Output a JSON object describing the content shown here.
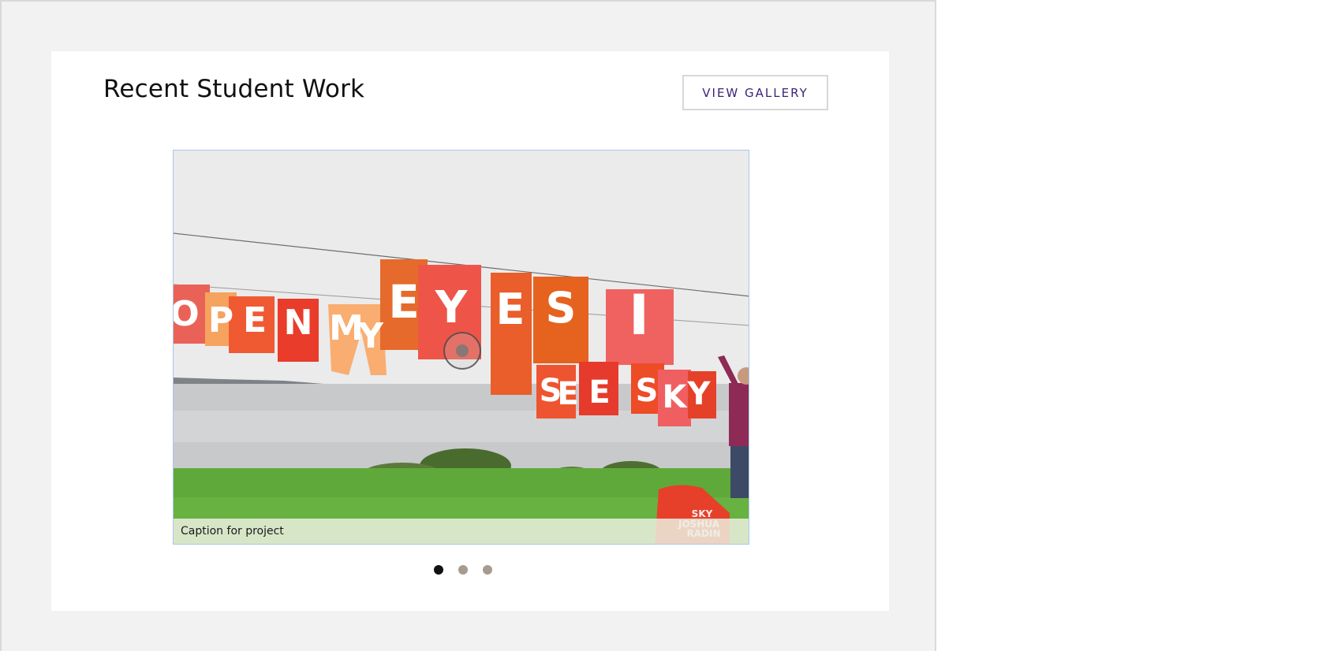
{
  "section": {
    "title": "Recent Student Work",
    "gallery_button_label": "VIEW GALLERY"
  },
  "carousel": {
    "caption": "Caption for project",
    "slide_count": 3,
    "active_index": 0,
    "image_description_words": {
      "top_row": [
        "O",
        "P",
        "E",
        "N",
        "M",
        "Y",
        "E",
        "Y",
        "E",
        "S",
        "I"
      ],
      "bottom_row": [
        "S",
        "E",
        "E",
        "S",
        "K",
        "Y"
      ],
      "bag_text": [
        "SKY",
        "JOSHUA",
        "RADIN"
      ]
    }
  },
  "colors": {
    "page_background": "#f2f2f2",
    "card_background": "#ffffff",
    "button_text": "#3c2575",
    "active_dot": "#111111",
    "inactive_dot": "#a69b8f"
  }
}
